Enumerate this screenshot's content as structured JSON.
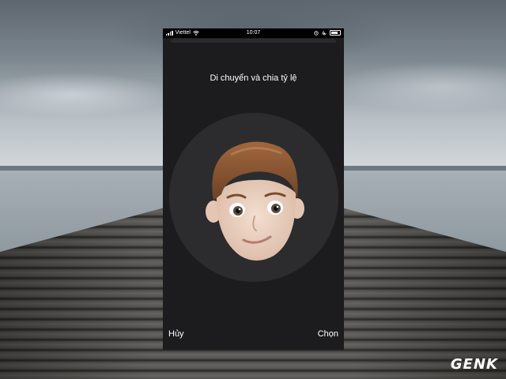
{
  "status_bar": {
    "carrier": "Viettel",
    "time": "10:07"
  },
  "title": "Di chuyển và chia tỷ lệ",
  "buttons": {
    "cancel": "Hủy",
    "choose": "Chọn"
  },
  "watermark": "GENK",
  "colors": {
    "sheet_background": "#1c1c1e",
    "circle_background": "#2c2c2e",
    "text": "#ffffff"
  },
  "icons": [
    "signal-icon",
    "wifi-icon",
    "alarm-icon",
    "rotation-lock-icon",
    "battery-icon"
  ]
}
